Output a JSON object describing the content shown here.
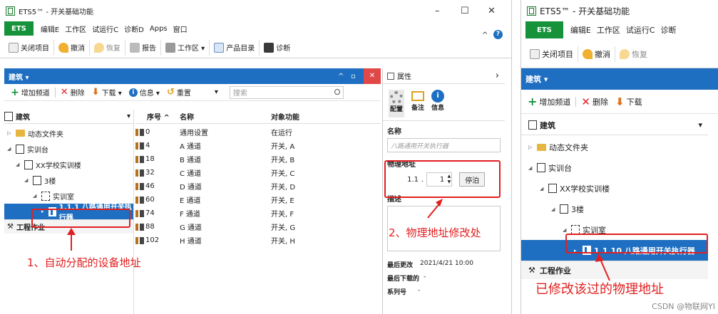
{
  "left_window": {
    "title": "ETS5™ - 开关基础功能",
    "window_controls": [
      "–",
      "☐",
      "✕"
    ],
    "menu": {
      "ets": "ETS",
      "items": [
        "编辑E",
        "工作区",
        "试运行C",
        "诊断D",
        "Apps",
        "窗口"
      ],
      "right": [
        "^",
        "?"
      ]
    },
    "toolbar": [
      "关闭项目",
      "撤消",
      "恢复",
      "报告",
      "工作区 ▾",
      "产品目录",
      "诊断"
    ],
    "panel_title": "建筑 ▾",
    "panel_controls": [
      "^",
      "▫",
      "✕"
    ],
    "cmdbar": {
      "add": "增加频道",
      "delete": "删除",
      "download": "下载 ▾",
      "info": "信息 ▾",
      "reset": "重置",
      "dropdown": "▾",
      "search_placeholder": "搜索"
    },
    "tree_header": "建筑",
    "tree": [
      {
        "label": "动态文件夹",
        "indent": 0,
        "arrow": "▷"
      },
      {
        "label": "实训台",
        "indent": 0,
        "arrow": "◢"
      },
      {
        "label": "XX学校实训楼",
        "indent": 1,
        "arrow": "◢"
      },
      {
        "label": "3楼",
        "indent": 2,
        "arrow": "◢"
      },
      {
        "label": "实训室",
        "indent": 3,
        "arrow": "◢"
      },
      {
        "label": "1.1.1 八路通用开关执行器",
        "indent": 4,
        "arrow": "▸",
        "selected": true
      }
    ],
    "tree_footer": "工程作业",
    "grid": {
      "columns": [
        "序号 ^",
        "名称",
        "对象功能"
      ],
      "rows": [
        {
          "num": "0",
          "name": "通用设置",
          "func": "在运行"
        },
        {
          "num": "4",
          "name": "A 通道",
          "func": "开关, A"
        },
        {
          "num": "18",
          "name": "B 通道",
          "func": "开关, B"
        },
        {
          "num": "32",
          "name": "C 通道",
          "func": "开关, C"
        },
        {
          "num": "46",
          "name": "D 通道",
          "func": "开关, D"
        },
        {
          "num": "60",
          "name": "E 通道",
          "func": "开关, E"
        },
        {
          "num": "74",
          "name": "F 通道",
          "func": "开关, F"
        },
        {
          "num": "88",
          "name": "G 通道",
          "func": "开关, G"
        },
        {
          "num": "102",
          "name": "H 通道",
          "func": "开关, H"
        }
      ]
    },
    "properties": {
      "title": "属性",
      "chevron": "›",
      "tabs": [
        "配置",
        "备注",
        "信息"
      ],
      "name_label": "名称",
      "name_placeholder": "八路通用开关执行器",
      "addr_label": "物理地址",
      "addr_prefix": "1.1",
      "addr_dot": ".",
      "addr_value": "1",
      "park_button": "停泊",
      "desc_label": "描述",
      "last_modified_label": "最后更改",
      "last_modified_value": "2021/4/21 10:00",
      "last_download_label": "最后下载的",
      "last_download_value": "-",
      "serial_label": "系列号",
      "serial_value": "-"
    },
    "annotations": {
      "a1": "1、自动分配的设备地址",
      "a2": "2、物理地址修改处"
    }
  },
  "right_window": {
    "title": "ETS5™ - 开关基础功能",
    "menu": {
      "ets": "ETS",
      "items": [
        "编辑E",
        "工作区",
        "试运行C",
        "诊断"
      ]
    },
    "toolbar": [
      "关闭项目",
      "撤消",
      "恢复"
    ],
    "panel_title": "建筑 ▾",
    "cmdbar": {
      "add": "增加频道",
      "delete": "删除",
      "download": "下载"
    },
    "tree_header": "建筑",
    "tree": [
      {
        "label": "动态文件夹",
        "indent": 0,
        "arrow": "▷"
      },
      {
        "label": "实训台",
        "indent": 0,
        "arrow": "◢"
      },
      {
        "label": "XX学校实训楼",
        "indent": 1,
        "arrow": "◢"
      },
      {
        "label": "3楼",
        "indent": 2,
        "arrow": "◢"
      },
      {
        "label": "实训室",
        "indent": 3,
        "arrow": "◢"
      },
      {
        "label": "1.1.10 八路通用开关执行器",
        "indent": 4,
        "arrow": "▸",
        "selected": true
      }
    ],
    "tree_footer": "工程作业",
    "annotation": "已修改该过的物理地址",
    "watermark": "CSDN @物联网YI"
  },
  "colors": {
    "ets_green": "#16923b",
    "blue": "#1e6fc1",
    "red": "#e02020"
  }
}
